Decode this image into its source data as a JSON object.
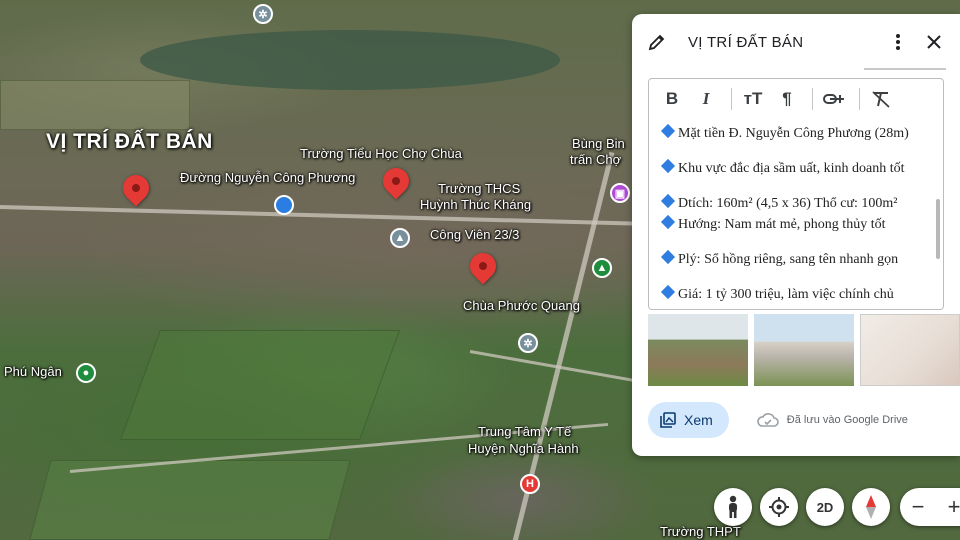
{
  "map": {
    "title": "VỊ TRÍ ĐẤT BÁN",
    "labels": {
      "school1": "Trường Tiểu Học Chợ Chùa",
      "street": "Đường Nguyễn Công Phương",
      "school2_line1": "Trường THCS",
      "school2_line2": "Huỳnh Thúc Kháng",
      "park": "Công Viên 23/3",
      "pagoda": "Chùa Phước Quang",
      "bus_line1": "Bùng Bin",
      "bus_line2": "trấn Chợ",
      "phu_ngan": "Phú Ngân",
      "medical_line1": "Trung Tâm Y Tế",
      "medical_line2": "Huyện Nghĩa Hành",
      "high_school": "Trường THPT"
    },
    "pin_color": "#e53935"
  },
  "panel": {
    "title": "VỊ TRÍ ĐẤT BÁN",
    "toolbar": {
      "bold": "B",
      "italic": "I",
      "text_size": "тT",
      "paragraph": "¶"
    },
    "content": [
      "Mặt tiền Đ. Nguyễn Công Phương (28m)",
      "Khu vực đắc địa sầm uất, kinh doanh tốt",
      "Dtích: 160m² (4,5 x 36) Thổ cư: 100m²",
      "Hướng: Nam mát mẻ, phong thủy tốt",
      "Plý: Sổ hồng riêng, sang tên nhanh gọn",
      "Giá: 1 tỷ 300 triệu, làm việc chính chủ"
    ],
    "view_button": "Xem",
    "saved_text": "Đã lưu vào Google Drive",
    "accent_color": "#d3e7fd"
  },
  "controls": {
    "mode_2d": "2D",
    "zoom_out": "−",
    "zoom_in": "+"
  }
}
